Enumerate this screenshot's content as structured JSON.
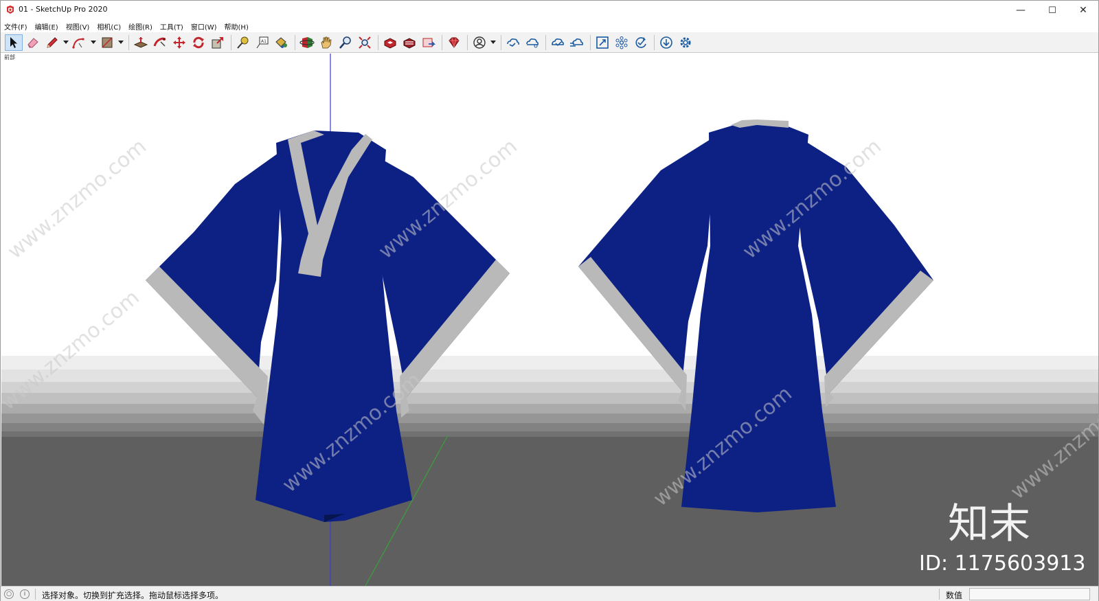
{
  "window": {
    "title": "01 - SketchUp Pro 2020",
    "controls": {
      "minimize": "—",
      "maximize": "☐",
      "close": "✕"
    }
  },
  "menu": {
    "items": [
      {
        "label": "文件(F)"
      },
      {
        "label": "编辑(E)"
      },
      {
        "label": "视图(V)"
      },
      {
        "label": "相机(C)"
      },
      {
        "label": "绘图(R)"
      },
      {
        "label": "工具(T)"
      },
      {
        "label": "窗口(W)"
      },
      {
        "label": "帮助(H)"
      }
    ]
  },
  "toolbar": {
    "tools": [
      "select-icon",
      "eraser-icon",
      "pencil-icon",
      "arc-icon",
      "rectangle-icon",
      "push-pull-icon",
      "follow-me-icon",
      "move-icon",
      "rotate-icon",
      "scale-icon",
      "tape-measure-icon",
      "text-icon",
      "paint-bucket-icon",
      "orbit-icon",
      "pan-icon",
      "zoom-icon",
      "zoom-extents-icon",
      "3d-warehouse-icon",
      "extension-warehouse-icon",
      "send-to-layout-icon",
      "ruby-console-icon",
      "profile-icon",
      "trimble-connect-icon",
      "trimble-share-icon",
      "cloud-upload-icon",
      "cloud-sync-icon",
      "fit-icon",
      "components-icon",
      "check-icon",
      "download-icon",
      "settings-icon"
    ]
  },
  "viewport": {
    "scene_label": "前部",
    "watermark": "www.znzmo.com",
    "brand_mark": "知末",
    "brand_id": "ID: 1175603913",
    "colors": {
      "robe": "#0d2185",
      "trim": "#b9b9b9",
      "ground": "#5f5f5f",
      "sky": "#ffffff"
    }
  },
  "status": {
    "message": "选择对象。切换到扩充选择。拖动鼠标选择多项。",
    "measurements_label": "数值",
    "measurements_value": ""
  }
}
